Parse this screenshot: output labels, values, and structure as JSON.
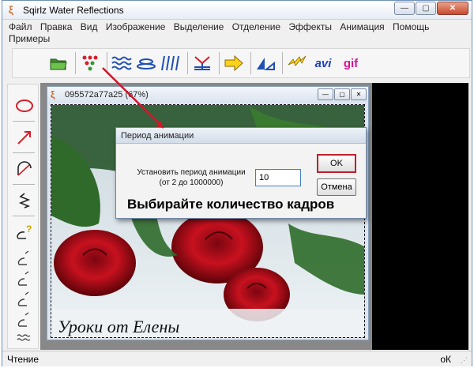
{
  "window": {
    "title": "Sqirlz Water Reflections",
    "buttons": {
      "minimize": "—",
      "maximize": "▢",
      "close": "✕"
    }
  },
  "menu": {
    "items": [
      "Файл",
      "Правка",
      "Вид",
      "Изображение",
      "Выделение",
      "Отделение",
      "Эффекты",
      "Анимация",
      "Помощь",
      "Примеры"
    ]
  },
  "toolbar": {
    "avi_label": "avi",
    "gif_label": "gif"
  },
  "image_window": {
    "title": "095572a77a25 (67%)",
    "watermark": "Уроки от Елены"
  },
  "dialog": {
    "title": "Период анимации",
    "label_line1": "Установить период анимации",
    "label_line2": "(от 2 до 1000000)",
    "value": "10",
    "ok_label": "OK",
    "cancel_label": "Отмена",
    "caption": "Выбирайте количество кадров"
  },
  "status": {
    "left": "Чтение",
    "right": "оК"
  },
  "colors": {
    "highlight": "#c21e2a",
    "accent_blue": "#1f4fb5",
    "gif_magenta": "#d1158f",
    "avi_blue": "#1a3ec9"
  }
}
